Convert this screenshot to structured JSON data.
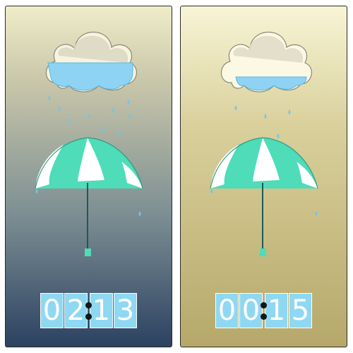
{
  "colors": {
    "rain": "#6fc6ee",
    "umbrella_mint": "#4fdcb8",
    "umbrella_white": "#ffffff",
    "cloud_fill": "#8fd3f4",
    "digit_bg": "#8fd8f2"
  },
  "panels": [
    {
      "name": "left",
      "cloud_fill_level": 0.45,
      "timer": {
        "d1": "0",
        "d2": "2",
        "d3": "1",
        "d4": "3"
      }
    },
    {
      "name": "right",
      "cloud_fill_level": 0.2,
      "timer": {
        "d1": "0",
        "d2": "0",
        "d3": "1",
        "d4": "5"
      }
    }
  ]
}
